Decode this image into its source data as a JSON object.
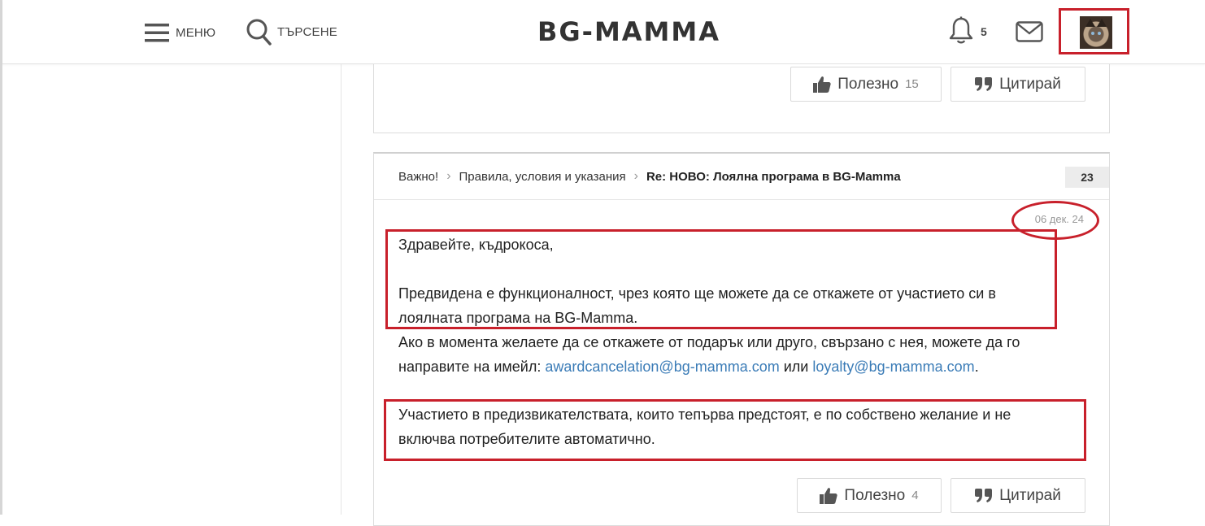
{
  "header": {
    "menu_label": "МЕНЮ",
    "search_label": "ТЪРСЕНЕ",
    "logo": "BG-MAMMA",
    "notifications_count": "5",
    "icons": [
      "hamburger-icon",
      "search-icon",
      "bell-icon",
      "mail-icon",
      "avatar"
    ]
  },
  "prev_post": {
    "like_label": "Полезно",
    "like_count": "15",
    "quote_label": "Цитирай"
  },
  "post": {
    "breadcrumb": [
      "Важно!",
      "Правила, условия и указания",
      "Re: НОВО: Лоялна програма в BG-Mamma"
    ],
    "number": "23",
    "date": "06 дек. 24",
    "greeting": "Здравейте, къдрокоса,",
    "para1_line1": "Предвидена е функционалност, чрез която ще можете да се откажете от участието си в",
    "para1_line2": "лоялната програма на BG-Mamma.",
    "para2_line1": "Ако в момента желаете да се откажете от подарък или друго, свързано с нея, можете да го",
    "para2_prefix": "направите на имейл: ",
    "email1": "awardcancelation@bg-mamma.com",
    "or_word": " или ",
    "email2": "loyalty@bg-mamma.com",
    "period": ".",
    "para3_line1": "Участието в предизвикателствата, които тепърва предстоят, е по собствено желание и не",
    "para3_line2": "включва потребителите автоматично.",
    "like_label": "Полезно",
    "like_count": "4",
    "quote_label": "Цитирай"
  },
  "colors": {
    "annotation_red": "#c8202b",
    "link_blue": "#3b7cb7"
  }
}
